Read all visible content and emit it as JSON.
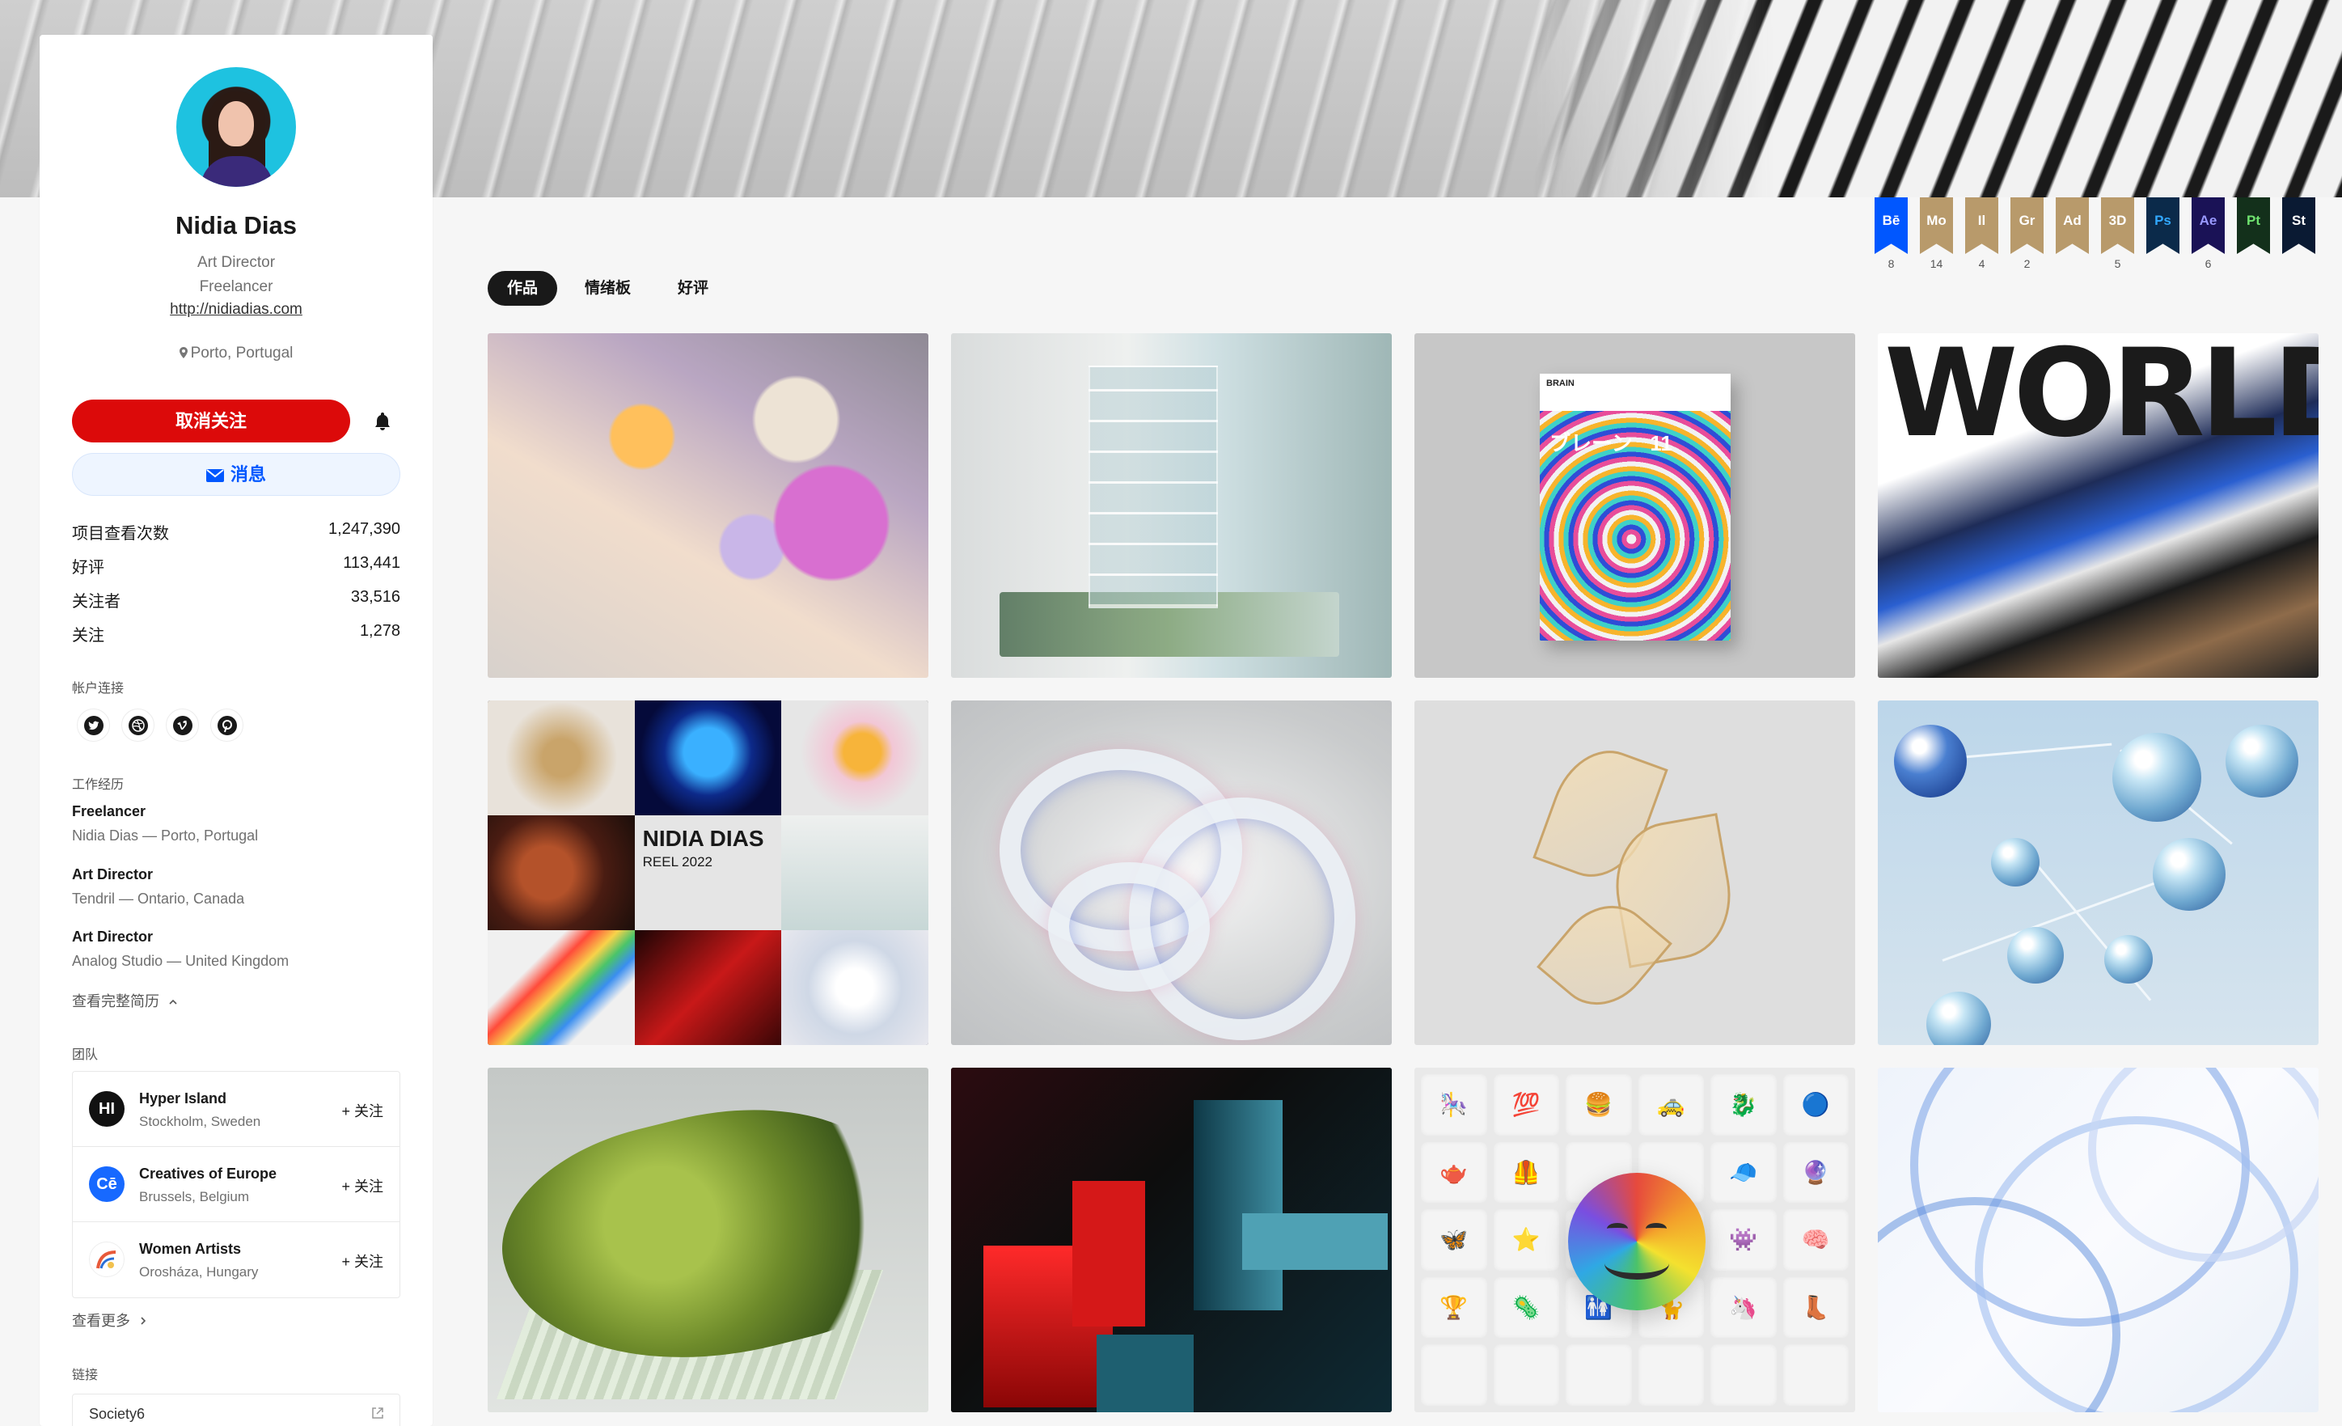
{
  "profile": {
    "name": "Nidia Dias",
    "role": "Art Director",
    "status": "Freelancer",
    "website": "http://nidiadias.com",
    "location": "Porto, Portugal"
  },
  "actions": {
    "unfollow_label": "取消关注",
    "message_label": "消息"
  },
  "stats": [
    {
      "label": "项目查看次数",
      "value": "1,247,390"
    },
    {
      "label": "好评",
      "value": "113,441"
    },
    {
      "label": "关注者",
      "value": "33,516"
    },
    {
      "label": "关注",
      "value": "1,278"
    }
  ],
  "sections": {
    "accounts": "帐户连接",
    "work": "工作经历",
    "team": "团队",
    "links": "链接"
  },
  "socials": [
    "twitter-icon",
    "dribbble-icon",
    "vimeo-icon",
    "pinterest-icon"
  ],
  "work": [
    {
      "title": "Freelancer",
      "detail": "Nidia Dias — Porto, Portugal"
    },
    {
      "title": "Art Director",
      "detail": "Tendril — Ontario, Canada"
    },
    {
      "title": "Art Director",
      "detail": "Analog Studio — United Kingdom"
    }
  ],
  "work_more": "查看完整简历",
  "teams": [
    {
      "name": "Hyper Island",
      "location": "Stockholm, Sweden",
      "logo": "HI",
      "color": "#111111",
      "follow": "+ 关注"
    },
    {
      "name": "Creatives of Europe",
      "location": "Brussels, Belgium",
      "logo": "Cē",
      "color": "#1769ff",
      "follow": "+ 关注"
    },
    {
      "name": "Women Artists",
      "location": "Orosháza, Hungary",
      "logo": "",
      "color": "#ffffff",
      "follow": "+ 关注"
    }
  ],
  "teams_more": "查看更多",
  "links": [
    {
      "label": "Society6"
    }
  ],
  "badges": [
    {
      "label": "Bē",
      "count": "8",
      "color": "#0057ff"
    },
    {
      "label": "Mo",
      "count": "14",
      "color": "#b89a6b"
    },
    {
      "label": "Il",
      "count": "4",
      "color": "#b89a6b"
    },
    {
      "label": "Gr",
      "count": "2",
      "color": "#b89a6b"
    },
    {
      "label": "Ad",
      "count": "",
      "color": "#b89a6b"
    },
    {
      "label": "3D",
      "count": "5",
      "color": "#b89a6b"
    },
    {
      "label": "Ps",
      "count": "",
      "color": "#0b2a4a"
    },
    {
      "label": "Ae",
      "count": "6",
      "color": "#1a1256"
    },
    {
      "label": "Pt",
      "count": "",
      "color": "#13301b"
    },
    {
      "label": "St",
      "count": "",
      "color": "#0a1a33"
    }
  ],
  "tabs": [
    {
      "label": "作品",
      "active": true
    },
    {
      "label": "情绪板",
      "active": false
    },
    {
      "label": "好评",
      "active": false
    }
  ],
  "projects": {
    "c3_brand": "BRAIN",
    "c3_title": "ブレーン",
    "c3_issue": "11",
    "c4_text": "WORLDS",
    "c5_name": "NIDIA DIAS",
    "c5_reel": "REEL 2022"
  }
}
